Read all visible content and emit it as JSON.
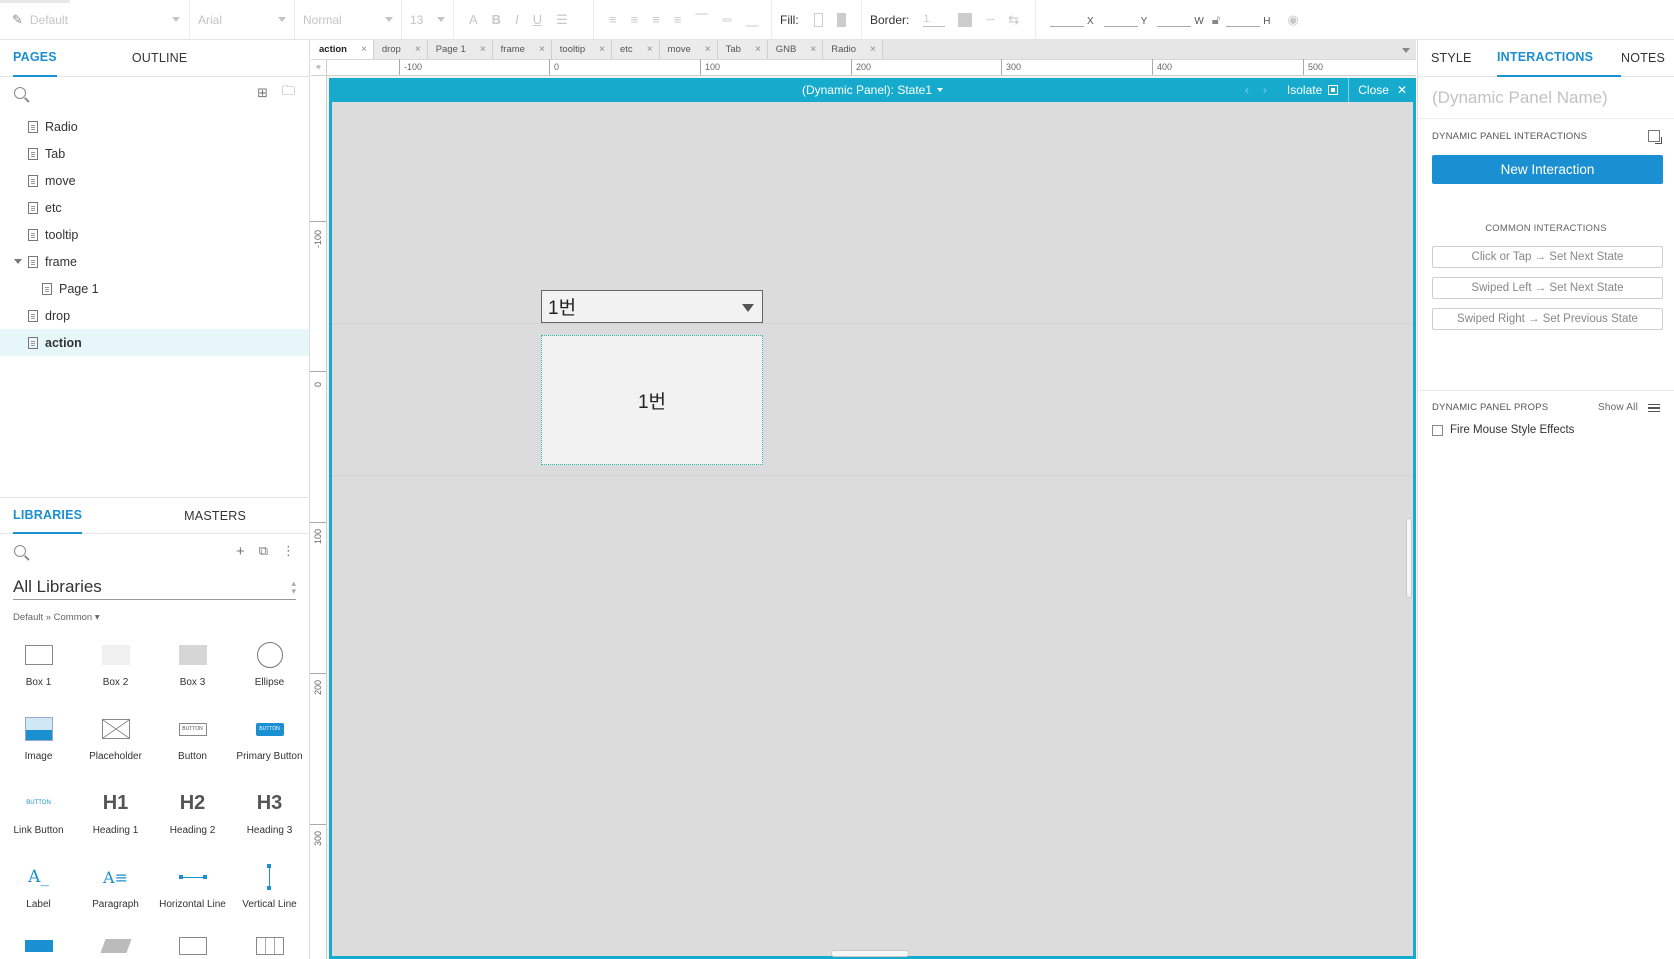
{
  "toolbar": {
    "style_select": "Default",
    "font_select": "Arial",
    "weight_select": "Normal",
    "size_select": "13",
    "fill_label": "Fill:",
    "border_label": "Border:",
    "border_value": "1",
    "coord_x": "X",
    "coord_y": "Y",
    "coord_w": "W",
    "coord_h": "H"
  },
  "left": {
    "tabs": [
      "PAGES",
      "OUTLINE"
    ],
    "pages": [
      {
        "label": "Radio"
      },
      {
        "label": "Tab"
      },
      {
        "label": "move"
      },
      {
        "label": "etc"
      },
      {
        "label": "tooltip"
      },
      {
        "label": "frame"
      },
      {
        "label": "Page 1"
      },
      {
        "label": "drop"
      },
      {
        "label": "action"
      }
    ],
    "lib_tabs": [
      "LIBRARIES",
      "MASTERS"
    ],
    "lib_select": "All Libraries",
    "crumb": "Default » Common ▾",
    "widgets": [
      {
        "label": "Box 1"
      },
      {
        "label": "Box 2"
      },
      {
        "label": "Box 3"
      },
      {
        "label": "Ellipse"
      },
      {
        "label": "Image"
      },
      {
        "label": "Placeholder"
      },
      {
        "label": "Button",
        "thumb": "BUTTON"
      },
      {
        "label": "Primary Button",
        "thumb": "BUTTON"
      },
      {
        "label": "Link Button",
        "thumb": "BUTTON"
      },
      {
        "label": "Heading 1",
        "thumb": "H1"
      },
      {
        "label": "Heading 2",
        "thumb": "H2"
      },
      {
        "label": "Heading 3",
        "thumb": "H3"
      },
      {
        "label": "Label",
        "thumb": "A_"
      },
      {
        "label": "Paragraph",
        "thumb": "A≡"
      },
      {
        "label": "Horizontal Line"
      },
      {
        "label": "Vertical Line"
      }
    ]
  },
  "center": {
    "tabs": [
      "action",
      "drop",
      "Page 1",
      "frame",
      "tooltip",
      "etc",
      "move",
      "Tab",
      "GNB",
      "Radio"
    ],
    "h_ruler": [
      "-100",
      "0",
      "100",
      "200",
      "300",
      "400",
      "500"
    ],
    "v_ruler": [
      "-100",
      "0",
      "100",
      "200",
      "300",
      "00"
    ],
    "panel_title": "(Dynamic Panel): State1",
    "isolate": "Isolate",
    "close": "Close",
    "dropdown_value": "1번",
    "state_text": "1번"
  },
  "right": {
    "tabs": [
      "STYLE",
      "INTERACTIONS",
      "NOTES"
    ],
    "name_placeholder": "(Dynamic Panel Name)",
    "interactions_head": "DYNAMIC PANEL INTERACTIONS",
    "new_interaction": "New Interaction",
    "common_title": "COMMON INTERACTIONS",
    "common": [
      "Click or Tap → Set Next State",
      "Swiped Left → Set Next State",
      "Swiped Right → Set Previous State"
    ],
    "props_head": "DYNAMIC PANEL PROPS",
    "show_all": "Show All",
    "fire_mouse": "Fire Mouse Style Effects"
  },
  "colors": {
    "accent": "#1a8fd1",
    "panel_frame": "#16aacd"
  }
}
